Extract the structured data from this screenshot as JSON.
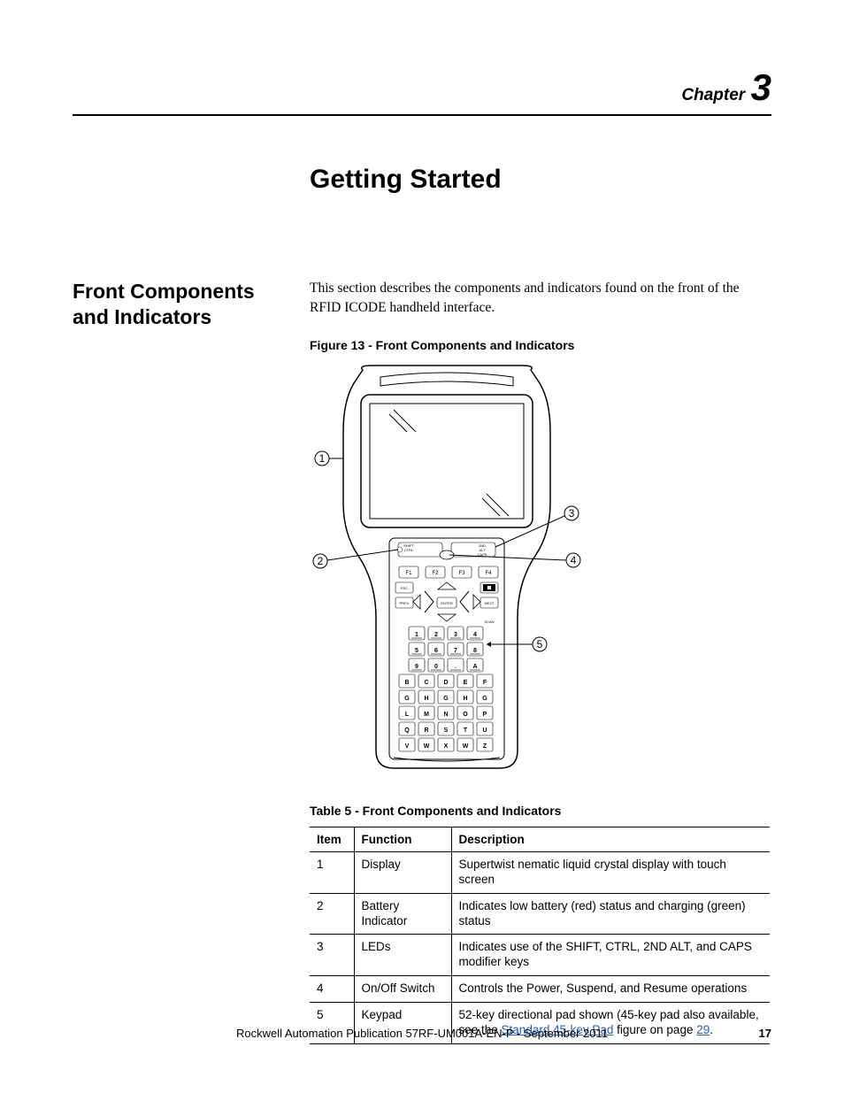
{
  "chapter": {
    "label": "Chapter",
    "number": "3"
  },
  "title": "Getting Started",
  "section": {
    "heading": "Front Components and Indicators",
    "intro": "This section describes the components and indicators found on the front of the RFID ICODE handheld interface."
  },
  "figure": {
    "caption": "Figure 13 - Front Components and Indicators",
    "callouts": [
      "1",
      "2",
      "3",
      "4",
      "5"
    ],
    "keys": {
      "fn": [
        "F1",
        "F2",
        "F3",
        "F4"
      ],
      "labels": {
        "esc": "ESC",
        "prev": "PREV",
        "enter": "ENTER",
        "next": "NEXT",
        "scan": "SCAN",
        "shift": "SHIFT",
        "ctrl": "CTRL",
        "alt": "ALT",
        "caps": "CAPS",
        "second": "2ND"
      },
      "row1": [
        "1",
        "2",
        "3",
        "4"
      ],
      "row2": [
        "5",
        "6",
        "7",
        "8"
      ],
      "row3": [
        "9",
        "0",
        ".",
        "A"
      ],
      "row4": [
        "B",
        "C",
        "D",
        "E",
        "F"
      ],
      "row5": [
        "G",
        "H",
        "G",
        "H",
        "G"
      ],
      "row6": [
        "L",
        "M",
        "N",
        "O",
        "P"
      ],
      "row7": [
        "Q",
        "R",
        "S",
        "T",
        "U"
      ],
      "row8": [
        "V",
        "W",
        "X",
        "W",
        "Z"
      ]
    }
  },
  "table": {
    "caption": "Table 5 - Front Components and Indicators",
    "headers": [
      "Item",
      "Function",
      "Description"
    ],
    "rows": [
      {
        "item": "1",
        "func": "Display",
        "desc": "Supertwist nematic liquid crystal display with touch screen"
      },
      {
        "item": "2",
        "func": "Battery Indicator",
        "desc": "Indicates low battery (red) status and charging (green) status"
      },
      {
        "item": "3",
        "func": "LEDs",
        "desc": "Indicates use of the SHIFT, CTRL, 2ND ALT, and CAPS modifier keys"
      },
      {
        "item": "4",
        "func": "On/Off Switch",
        "desc": "Controls the Power, Suspend, and Resume operations"
      },
      {
        "item": "5",
        "func": "Keypad",
        "desc_prefix": "52-key directional pad shown (45-key pad also available, see the ",
        "link_text": "Standard 45-key Pad",
        "desc_mid": " figure on page ",
        "page_link": "29",
        "desc_suffix": "."
      }
    ]
  },
  "footer": {
    "pub": "Rockwell Automation Publication 57RF-UM001A-EN-P - September 2011",
    "page": "17"
  }
}
